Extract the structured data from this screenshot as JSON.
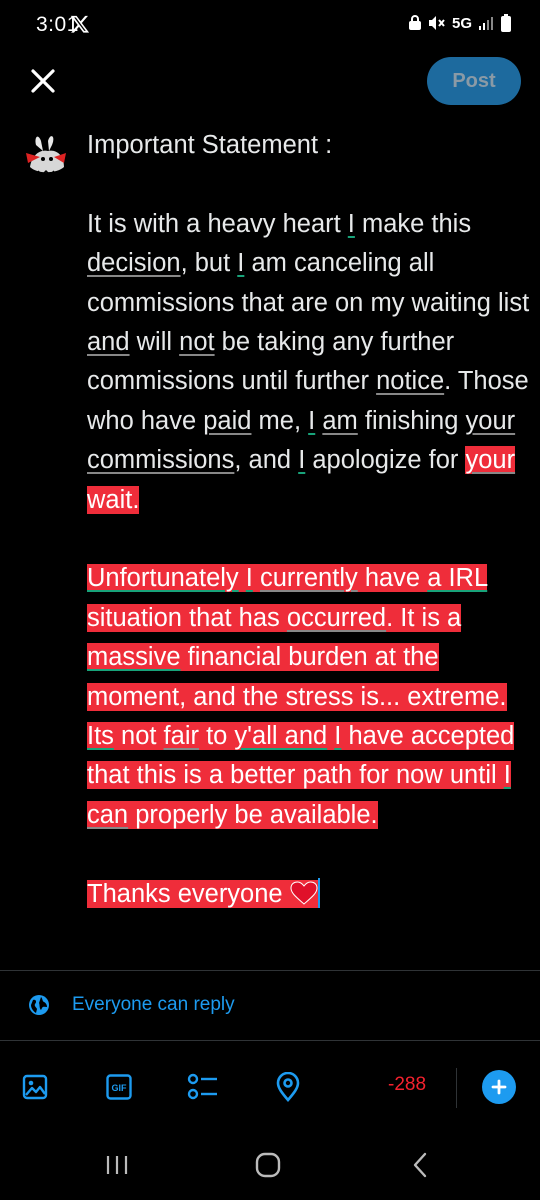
{
  "status_bar": {
    "time": "3:01",
    "network": "5G",
    "icons": [
      "x-logo-icon",
      "lock-icon",
      "mute-icon",
      "signal-icon",
      "battery-icon"
    ]
  },
  "header": {
    "close_icon": "close-icon",
    "post_label": "Post"
  },
  "compose": {
    "title": "Important Statement :",
    "p1": {
      "s01": "It is with a heavy heart ",
      "s02": "I",
      "s03": " make this ",
      "s04": "decision",
      "s05": ", but ",
      "s06": "I",
      "s07": " am canceling all commissions that are on my waiting list ",
      "s08": "and",
      "s09": " will ",
      "s10": "not",
      "s11": " be taking any further commissions until further ",
      "s12": "notice",
      "s13": ". Those who have ",
      "s14": "paid",
      "s15": " me, ",
      "s16": "I",
      "s17": " ",
      "s18": "am",
      "s19": " finishing ",
      "s20": "your",
      "s21": " ",
      "s22": "commissions",
      "s23": ", and ",
      "s24": "I",
      "s25": " apologize for ",
      "s26": "your",
      "s27": " wait."
    },
    "p2": {
      "s01": "Unfortunately",
      "s02": " ",
      "s03": "I",
      "s04": " ",
      "s05": "currently",
      "s06": " have ",
      "s07": "a IRL",
      "s08": " situation that has ",
      "s09": "occurred",
      "s10": ". It is a ",
      "s11": "massive",
      "s12": " financial burden at the moment, and the stress is... extreme. ",
      "s13": "Its",
      "s14": " not ",
      "s15": "fair",
      "s16": " to ",
      "s17": "y'all and",
      "s18": " ",
      "s19": "I",
      "s20": " have accepted that this is a better path for now until ",
      "s21": "I",
      "s22": " ",
      "s23": "can",
      "s24": " properly be available."
    },
    "p3": {
      "text": "Thanks everyone ",
      "emoji": "heart-icon"
    },
    "highlight_color": "#ef2d3a"
  },
  "reply_setting": {
    "icon": "globe-icon",
    "label": "Everyone can reply"
  },
  "toolbar": {
    "icons": [
      "image-icon",
      "gif-icon",
      "poll-icon",
      "location-icon",
      "add-icon"
    ],
    "char_count": "-288",
    "accent_color": "#1d9bf0",
    "warning_color": "#f4212e"
  },
  "nav_bar": {
    "icons": [
      "recents-icon",
      "home-icon",
      "back-icon"
    ]
  }
}
